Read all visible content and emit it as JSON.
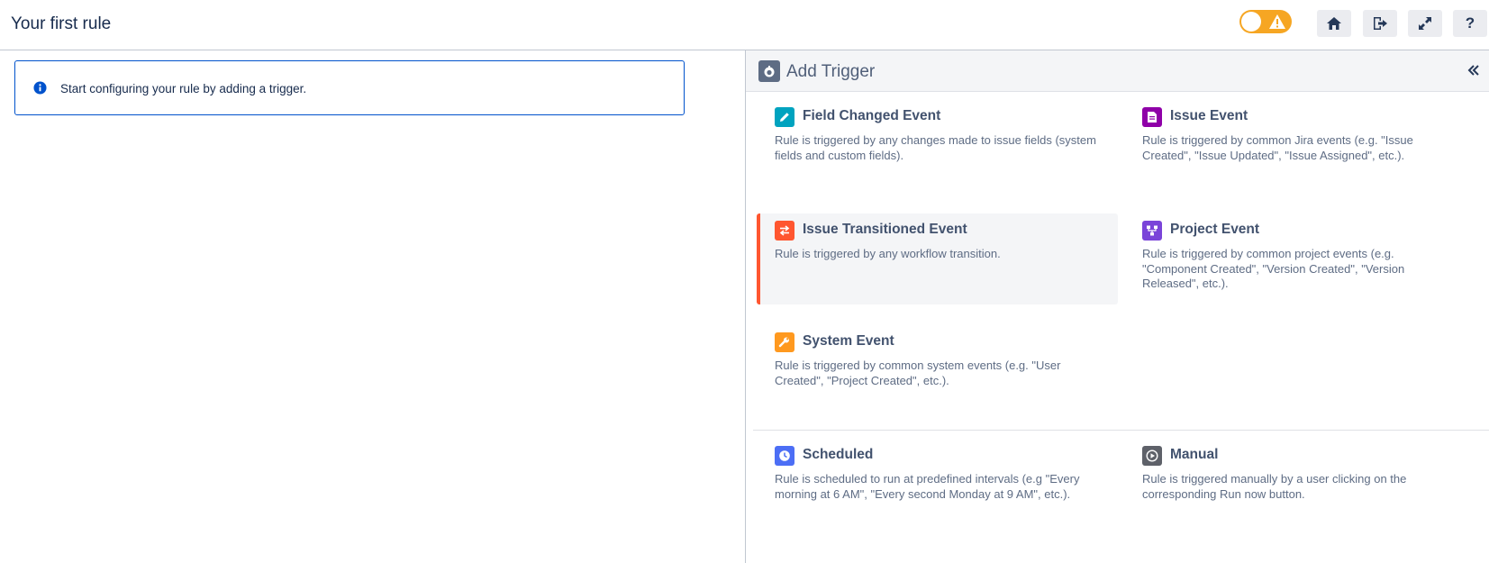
{
  "header": {
    "title": "Your first rule",
    "toggle_state": "disabled-warning",
    "buttons": [
      {
        "icon": "home-icon"
      },
      {
        "icon": "exit-icon"
      },
      {
        "icon": "expand-icon"
      },
      {
        "label": "?"
      }
    ]
  },
  "info": {
    "text": "Start configuring your rule by adding a trigger."
  },
  "panel": {
    "title": "Add Trigger",
    "triggers": [
      {
        "title": "Field Changed Event",
        "description": "Rule is triggered by any changes made to issue fields (system fields and custom fields).",
        "icon": "pencil-icon",
        "color": "#00a3bf"
      },
      {
        "title": "Issue Event",
        "description": "Rule is triggered by common Jira events (e.g. \"Issue Created\", \"Issue Updated\", \"Issue Assigned\", etc.).",
        "icon": "document-icon",
        "color": "#8f00a8"
      },
      {
        "title": "Issue Transitioned Event",
        "description": "Rule is triggered by any workflow transition.",
        "icon": "transition-arrows-icon",
        "color": "#ff5630",
        "selected": true
      },
      {
        "title": "Project Event",
        "description": "Rule is triggered by common project events (e.g. \"Component Created\", \"Version Created\", \"Version Released\", etc.).",
        "icon": "hierarchy-icon",
        "color": "#7a44d9"
      },
      {
        "title": "System Event",
        "description": "Rule is triggered by common system events (e.g. \"User Created\", \"Project Created\", etc.).",
        "icon": "wrench-icon",
        "color": "#ff991f"
      },
      {
        "title": "Scheduled",
        "description": "Rule is scheduled to run at predefined intervals (e.g \"Every morning at 6 AM\", \"Every second Monday at 9 AM\", etc.).",
        "icon": "clock-icon",
        "color": "#4c6ef5"
      },
      {
        "title": "Manual",
        "description": "Rule is triggered manually by a user clicking on the corresponding Run now button.",
        "icon": "play-icon",
        "color": "#5e6169"
      }
    ]
  },
  "colors": {
    "accent": "#0052cc",
    "selected_border": "#ff5630",
    "toggle": "#f6a623"
  }
}
